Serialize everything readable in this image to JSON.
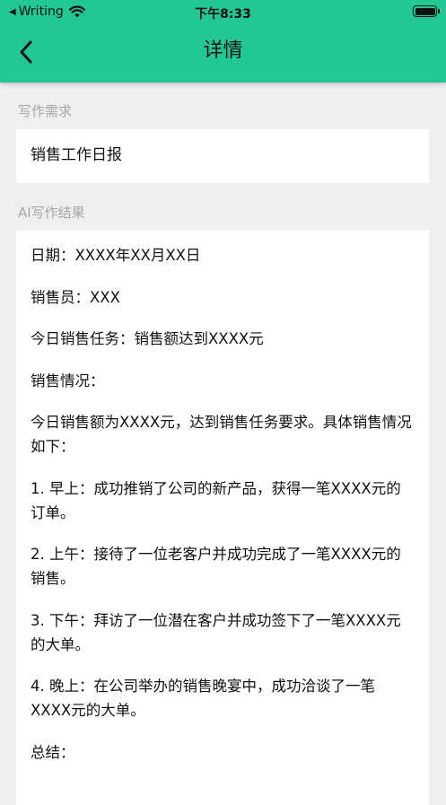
{
  "status_bar": {
    "back_arrow": "◀",
    "carrier": "Writing",
    "time": "下午8:33"
  },
  "nav": {
    "title": "详情"
  },
  "requirement": {
    "label": "写作需求",
    "text": "销售工作日报"
  },
  "result": {
    "label": "AI写作结果",
    "paragraphs": [
      "日期：XXXX年XX月XX日",
      "销售员：XXX",
      "今日销售任务：销售额达到XXXX元",
      "销售情况：",
      "今日销售额为XXXX元，达到销售任务要求。具体销售情况如下：",
      "1. 早上：成功推销了公司的新产品，获得一笔XXXX元的订单。",
      "2. 上午：接待了一位老客户并成功完成了一笔XXXX元的销售。",
      "3. 下午：拜访了一位潜在客户并成功签下了一笔XXXX元的大单。",
      "4. 晚上：在公司举办的销售晚宴中，成功洽谈了一笔XXXX元的大单。",
      "总结："
    ]
  },
  "colors": {
    "header_bg": "#22c795",
    "page_bg": "#efefef",
    "card_bg": "#ffffff",
    "label_text": "#a6a6a6"
  },
  "icons": {
    "back": "chevron-left-icon",
    "wifi": "wifi-icon",
    "battery": "battery-icon"
  }
}
